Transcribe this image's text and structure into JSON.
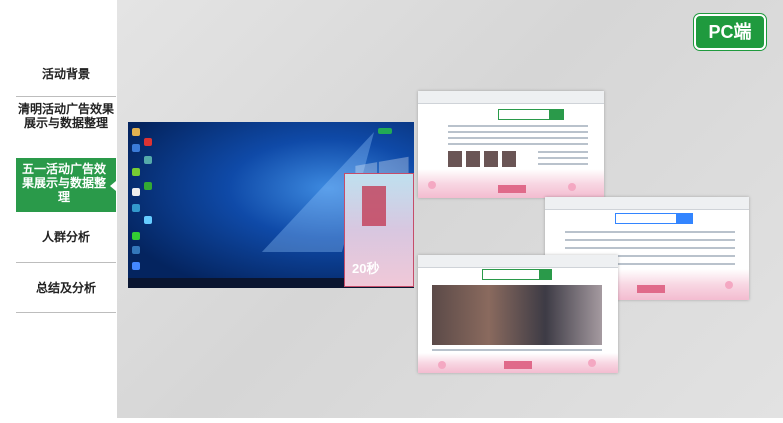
{
  "sidebar": {
    "items": [
      {
        "label": "活动背景"
      },
      {
        "label": "清明活动广告效果展示与数据整理"
      },
      {
        "label": "五一活动广告效果展示与数据整理"
      },
      {
        "label": "人群分析"
      },
      {
        "label": "总结及分析"
      }
    ]
  },
  "badge": {
    "label": "PC端"
  },
  "desktop": {
    "popup_timer": "20秒"
  },
  "colors": {
    "accent": "#2a9a4a",
    "badge": "#1f9a3e"
  }
}
